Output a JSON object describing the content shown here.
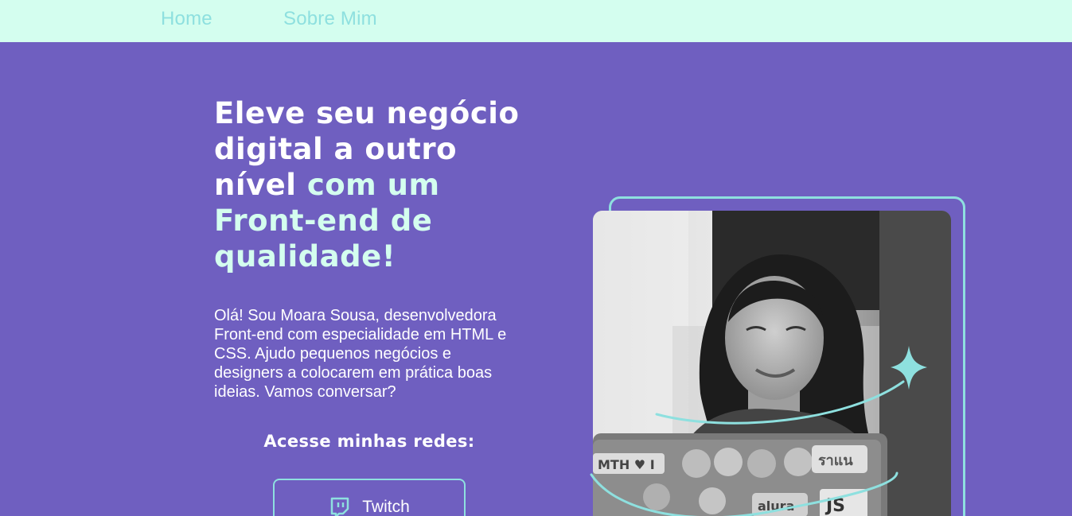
{
  "nav": {
    "home": "Home",
    "about": "Sobre Mim"
  },
  "hero": {
    "headline_white": "Eleve seu negócio digital a outro nível ",
    "headline_accent": "com um Front-end de qualidade!",
    "intro": "Olá! Sou Moara Sousa, desenvolvedora Front-end com especialidade em HTML e CSS. Ajudo pequenos negócios e designers a colocarem em prática boas ideias. Vamos conversar?",
    "social_title": "Acesse minhas redes:",
    "social_buttons": [
      {
        "label": "Twitch",
        "icon": "twitch-icon"
      }
    ]
  },
  "photo": {
    "icon": "portrait-photo",
    "laptop_stickers": [
      "MTH ♥ I",
      "ราแน",
      "JS",
      "alura"
    ]
  },
  "colors": {
    "background": "#6f5fc0",
    "nav_background": "#d4feef",
    "accent": "#8ee0df",
    "headline_accent": "#d4feef",
    "text": "#ffffff"
  }
}
